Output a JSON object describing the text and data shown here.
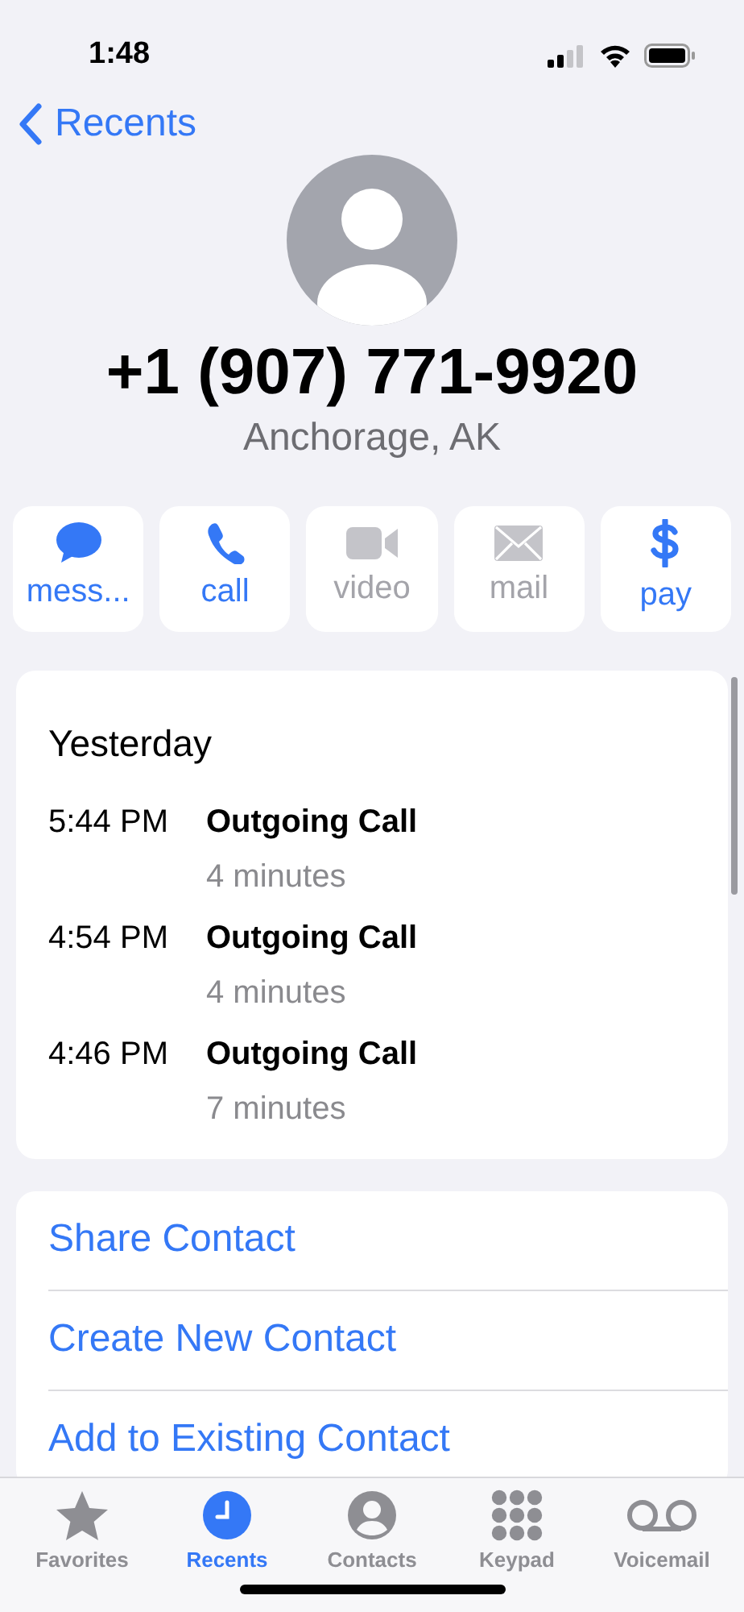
{
  "status_bar": {
    "time": "1:48"
  },
  "nav": {
    "back_label": "Recents"
  },
  "contact": {
    "number": "+1 (907) 771-9920",
    "location": "Anchorage, AK"
  },
  "actions": [
    {
      "kind": "message",
      "label": "mess...",
      "disabled": false
    },
    {
      "kind": "call",
      "label": "call",
      "disabled": false
    },
    {
      "kind": "video",
      "label": "video",
      "disabled": true
    },
    {
      "kind": "mail",
      "label": "mail",
      "disabled": true
    },
    {
      "kind": "pay",
      "label": "pay",
      "disabled": false
    }
  ],
  "call_log": {
    "heading": "Yesterday",
    "calls": [
      {
        "time": "5:44 PM",
        "type": "Outgoing Call",
        "duration": "4 minutes"
      },
      {
        "time": "4:54 PM",
        "type": "Outgoing Call",
        "duration": "4 minutes"
      },
      {
        "time": "4:46 PM",
        "type": "Outgoing Call",
        "duration": "7 minutes"
      }
    ]
  },
  "links": [
    "Share Contact",
    "Create New Contact",
    "Add to Existing Contact"
  ],
  "tab_bar": [
    {
      "kind": "favorites",
      "label": "Favorites",
      "selected": false
    },
    {
      "kind": "recents",
      "label": "Recents",
      "selected": true
    },
    {
      "kind": "contacts",
      "label": "Contacts",
      "selected": false
    },
    {
      "kind": "keypad",
      "label": "Keypad",
      "selected": false
    },
    {
      "kind": "voicemail",
      "label": "Voicemail",
      "selected": false
    }
  ]
}
